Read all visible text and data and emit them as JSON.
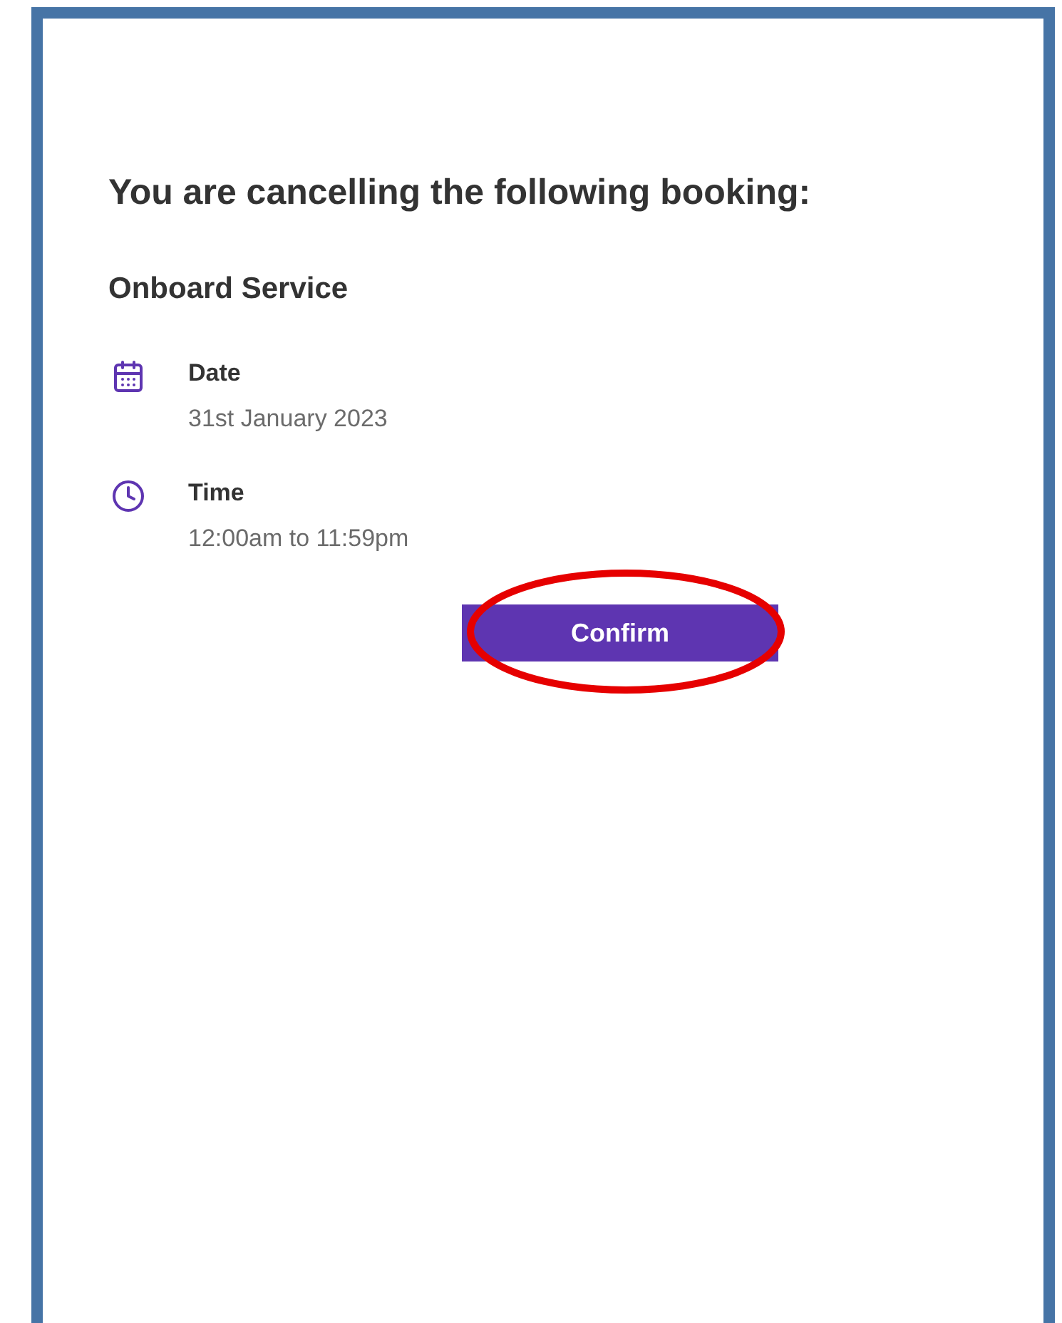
{
  "heading": "You are cancelling the following booking:",
  "service": "Onboard Service",
  "details": [
    {
      "kind": "date",
      "label": "Date",
      "value": "31st January 2023"
    },
    {
      "kind": "time",
      "label": "Time",
      "value": "12:00am to 11:59pm"
    }
  ],
  "button": {
    "label": "Confirm"
  }
}
